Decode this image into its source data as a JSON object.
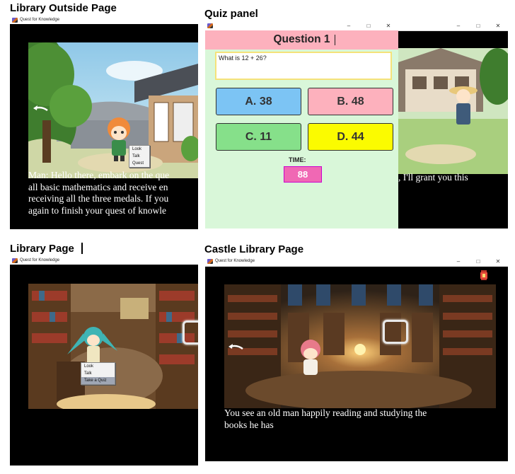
{
  "captions": {
    "outside": "Library Outside Page",
    "quiz": "Quiz panel",
    "library": "Library Page",
    "castle": "Castle Library Page"
  },
  "window": {
    "title": "Quest for Knowledge",
    "minimize": "–",
    "maximize": "□",
    "close": "✕"
  },
  "outside_page": {
    "dialogue_lines": [
      "Man: Hello there, embark on the que",
      "all basic mathematics and receive en",
      "receiving all the three medals. If you",
      "again to finish your quest of knowle"
    ],
    "menu": [
      "Look",
      "Talk",
      "Quest"
    ]
  },
  "quiz_panel": {
    "question_title": "Question 1",
    "question_text": "What is 12 + 26?",
    "answers": [
      {
        "label": "A. 38",
        "color": "#7cc4f4"
      },
      {
        "label": "B. 48",
        "color": "#fdb1bd"
      },
      {
        "label": "C. 11",
        "color": "#86e08a"
      },
      {
        "label": "D. 44",
        "color": "#fbfb00"
      }
    ],
    "time_label": "TIME:",
    "time_value": "88",
    "background_dialogue": ", I'll grant you this"
  },
  "library_page": {
    "menu": [
      "Look",
      "Talk",
      "Take a Quiz"
    ],
    "menu_highlight_index": 2
  },
  "castle_page": {
    "narration_lines": [
      "You see an old man happily reading and studying the",
      "books he has"
    ]
  }
}
